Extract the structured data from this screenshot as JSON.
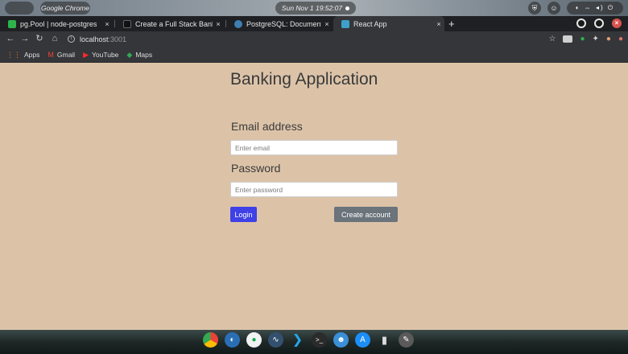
{
  "os": {
    "apple_glyph": "",
    "app_name": "Google Chrome",
    "clock": "Sun Nov 1  19:52:07"
  },
  "browser": {
    "tabs": [
      {
        "title": "pg.Pool | node-postgres",
        "favicon_color": "#2eb34a",
        "active": false
      },
      {
        "title": "Create a Full Stack Banking",
        "favicon_color": "#111111",
        "active": false
      },
      {
        "title": "PostgreSQL: Documentati",
        "favicon_color": "#3d7fb3",
        "active": false
      },
      {
        "title": "React App",
        "favicon_color": "#3da1ca",
        "active": true
      }
    ],
    "close_glyph": "×",
    "new_tab_glyph": "+",
    "url_host": "localhost",
    "url_port": ":3001",
    "bookmarks": [
      {
        "label": "Apps",
        "icon": "apps-grid-icon"
      },
      {
        "label": "Gmail",
        "icon": "gmail-icon"
      },
      {
        "label": "YouTube",
        "icon": "youtube-icon"
      },
      {
        "label": "Maps",
        "icon": "maps-icon"
      }
    ]
  },
  "app": {
    "title": "Banking Application",
    "email_label": "Email address",
    "email_placeholder": "Enter email",
    "email_value": "",
    "password_label": "Password",
    "password_placeholder": "Enter password",
    "password_value": "",
    "login_button": "Login",
    "create_account_button": "Create account"
  },
  "colors": {
    "page_background": "#dcc3a8",
    "login_button": "#3f40e6",
    "create_account_button": "#6b737b"
  },
  "dock": {
    "apps": [
      "chrome-icon",
      "dbeaver-icon",
      "mongodb-compass-icon",
      "pgadmin-icon",
      "vscode-icon",
      "terminal-icon",
      "finder-icon",
      "app-store-icon",
      "trash-icon",
      "system-settings-icon"
    ]
  }
}
